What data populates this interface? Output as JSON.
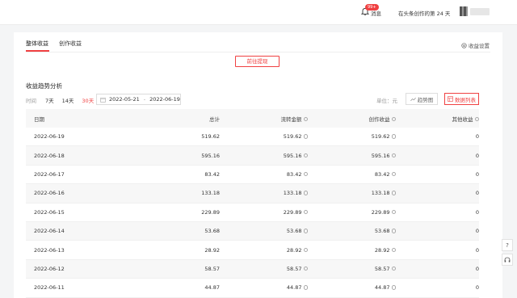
{
  "header": {
    "badge": "99+",
    "message_label": "消息",
    "days_text": "在头条创作的第 24 天"
  },
  "tabs": [
    {
      "label": "整体收益"
    },
    {
      "label": "创作收益"
    }
  ],
  "settings_label": "收益设置",
  "withdraw_label": "前往提现",
  "section_title": "收益趋势分析",
  "filter": {
    "label": "时间",
    "options": [
      "7天",
      "14天",
      "30天"
    ],
    "selected": "30天",
    "start_date": "2022-05-21",
    "separator": "-",
    "end_date": "2022-06-19"
  },
  "unit_label": "单位：元",
  "view_buttons": {
    "trend": "趋势图",
    "list": "数据列表"
  },
  "table": {
    "headers": [
      "日期",
      "总计",
      "流转金额",
      "创作收益",
      "其他收益"
    ],
    "rows": [
      [
        "2022-06-19",
        "519.62",
        "519.62",
        "519.62",
        "0"
      ],
      [
        "2022-06-18",
        "595.16",
        "595.16",
        "595.16",
        "0"
      ],
      [
        "2022-06-17",
        "83.42",
        "83.42",
        "83.42",
        "0"
      ],
      [
        "2022-06-16",
        "133.18",
        "133.18",
        "133.18",
        "0"
      ],
      [
        "2022-06-15",
        "229.89",
        "229.89",
        "229.89",
        "0"
      ],
      [
        "2022-06-14",
        "53.68",
        "53.68",
        "53.68",
        "0"
      ],
      [
        "2022-06-13",
        "28.92",
        "28.92",
        "28.92",
        "0"
      ],
      [
        "2022-06-12",
        "58.57",
        "58.57",
        "58.57",
        "0"
      ],
      [
        "2022-06-11",
        "44.87",
        "44.87",
        "44.87",
        "0"
      ]
    ]
  },
  "side_buttons": [
    "?",
    "headset"
  ],
  "colors": {
    "accent": "#f04142",
    "row_shade": "#f7f7f7"
  }
}
